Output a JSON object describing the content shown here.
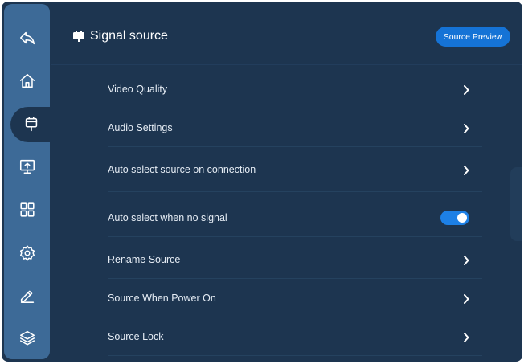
{
  "header": {
    "title": "Signal source",
    "preview_button": "Source Preview"
  },
  "rail": {
    "items": [
      {
        "icon": "back-icon"
      },
      {
        "icon": "home-icon"
      },
      {
        "icon": "signal-source-icon",
        "active": true
      },
      {
        "icon": "screen-icon"
      },
      {
        "icon": "apps-grid-icon"
      },
      {
        "icon": "gear-icon"
      },
      {
        "icon": "pen-icon"
      },
      {
        "icon": "layers-icon"
      }
    ]
  },
  "settings": {
    "rows": [
      {
        "label": "Video Quality",
        "control": "chevron"
      },
      {
        "label": "Audio Settings",
        "control": "chevron"
      },
      {
        "label": "Auto select source on connection",
        "control": "chevron"
      },
      {
        "label": "Auto select when no signal",
        "control": "toggle",
        "toggle_on": true
      },
      {
        "label": "Rename Source",
        "control": "chevron"
      },
      {
        "label": "Source When Power On",
        "control": "chevron"
      },
      {
        "label": "Source Lock",
        "control": "chevron"
      }
    ]
  },
  "colors": {
    "background": "#1d3550",
    "rail": "#3d6a97",
    "accent": "#1573d6"
  }
}
